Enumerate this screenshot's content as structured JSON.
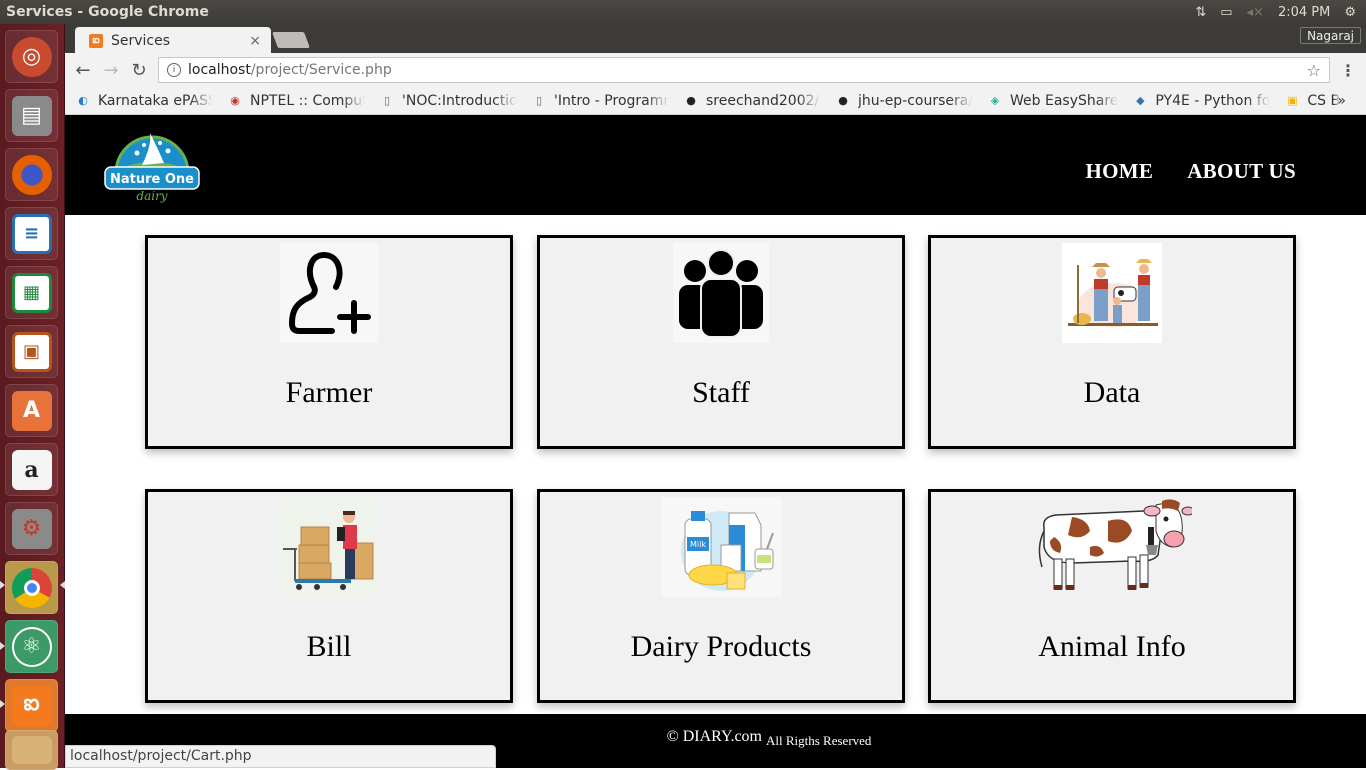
{
  "os": {
    "window_title": "Services - Google Chrome",
    "time": "2:04 PM",
    "indicators": [
      "network-icon",
      "battery-icon",
      "volume-muted-icon",
      "power-icon"
    ],
    "launcher": [
      {
        "name": "ubuntu-dash",
        "color": "#c84a2f"
      },
      {
        "name": "files",
        "color": "#8a8a8a"
      },
      {
        "name": "firefox",
        "color": "#e66000"
      },
      {
        "name": "libreoffice-writer",
        "color": "#2a6fb0"
      },
      {
        "name": "libreoffice-calc",
        "color": "#1e8a3a"
      },
      {
        "name": "libreoffice-impress",
        "color": "#b5541c"
      },
      {
        "name": "ubuntu-software",
        "color": "#e8733a"
      },
      {
        "name": "amazon",
        "color": "#f5f5f5"
      },
      {
        "name": "system-settings",
        "color": "#8a8a8a"
      },
      {
        "name": "chrome",
        "color": "#e9b632"
      },
      {
        "name": "atom",
        "color": "#3b9a66"
      },
      {
        "name": "xampp",
        "color": "#f47a20"
      },
      {
        "name": "trash",
        "color": "#c99d62"
      }
    ]
  },
  "browser": {
    "tab_title": "Services",
    "profile": "Nagaraj",
    "url_host": "localhost",
    "url_path": "/project/Service.php",
    "bookmarks": [
      {
        "label": "Karnataka ePASS",
        "icon": "epass-icon",
        "color": "#2a7dc9"
      },
      {
        "label": "NPTEL :: Computer",
        "icon": "nptel-icon",
        "color": "#c0392b"
      },
      {
        "label": "'NOC:Introduction",
        "icon": "page-icon",
        "color": "#666666"
      },
      {
        "label": "'Intro - Programming",
        "icon": "page-icon",
        "color": "#666666"
      },
      {
        "label": "sreechand2002/s",
        "icon": "github-icon",
        "color": "#222222"
      },
      {
        "label": "jhu-ep-coursera/",
        "icon": "github-icon",
        "color": "#222222"
      },
      {
        "label": "Web EasyShare",
        "icon": "easyshare-icon",
        "color": "#1ab394"
      },
      {
        "label": "PY4E - Python for",
        "icon": "python-icon",
        "color": "#3776ab"
      },
      {
        "label": "CS B",
        "icon": "classroom-icon",
        "color": "#f4b400"
      }
    ],
    "status_url": "localhost/project/Cart.php"
  },
  "site": {
    "logo_text": "Nature One",
    "logo_sub": "dairy",
    "nav": [
      "HOME",
      "ABOUT US"
    ],
    "cards": [
      {
        "label": "Farmer",
        "image": "add-user-icon"
      },
      {
        "label": "Staff",
        "image": "group-icon"
      },
      {
        "label": "Data",
        "image": "farmer-family-illustration"
      },
      {
        "label": "Bill",
        "image": "delivery-man-boxes-illustration"
      },
      {
        "label": "Dairy Products",
        "image": "dairy-products-illustration"
      },
      {
        "label": "Animal Info",
        "image": "cow-illustration"
      }
    ],
    "footer_brand": "© DIARY.com",
    "footer_rights": "All Rigths Reserved"
  }
}
